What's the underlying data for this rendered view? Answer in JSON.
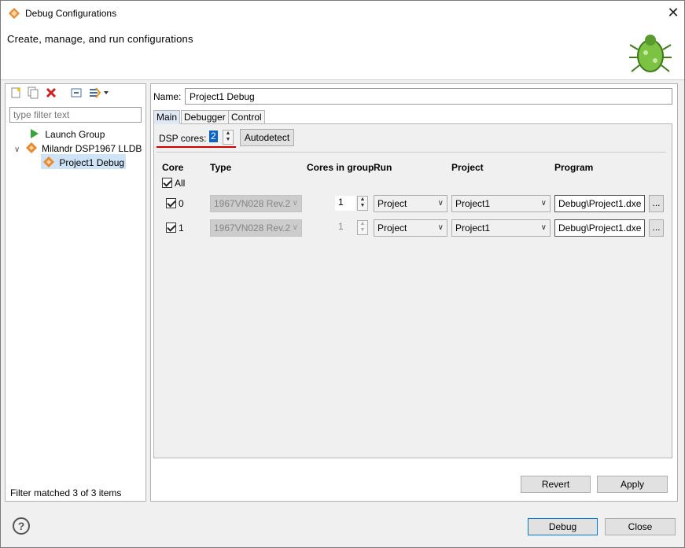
{
  "window": {
    "title": "Debug Configurations"
  },
  "header": {
    "text": "Create, manage, and run configurations"
  },
  "left": {
    "filter_placeholder": "type filter text",
    "tree": [
      {
        "label": "Launch Group"
      },
      {
        "label": "Milandr DSP1967 LLDB"
      },
      {
        "label": "Project1 Debug"
      }
    ],
    "status": "Filter matched 3 of 3 items"
  },
  "config": {
    "name_label": "Name:",
    "name_value": "Project1 Debug",
    "tabs": [
      "Main",
      "Debugger",
      "Control"
    ],
    "dsp_label": "DSP cores:",
    "dsp_value": "2",
    "autodetect": "Autodetect",
    "columns": [
      "Core",
      "Type",
      "Cores in group",
      "Run",
      "Project",
      "Program"
    ],
    "all_label": "All",
    "rows": [
      {
        "core": "0",
        "type": "1967VN028 Rev.2",
        "cores": "1",
        "run": "Project",
        "project": "Project1",
        "program": "Debug\\Project1.dxe",
        "browse": "..."
      },
      {
        "core": "1",
        "type": "1967VN028 Rev.2",
        "cores": "1",
        "run": "Project",
        "project": "Project1",
        "program": "Debug\\Project1.dxe",
        "browse": "..."
      }
    ],
    "revert": "Revert",
    "apply": "Apply"
  },
  "footer": {
    "debug": "Debug",
    "close": "Close",
    "help": "?"
  },
  "colors": {
    "accent": "#0078d7",
    "highlight": "#0a64c8",
    "underline": "#d00000",
    "selection": "#cfe3f7"
  }
}
